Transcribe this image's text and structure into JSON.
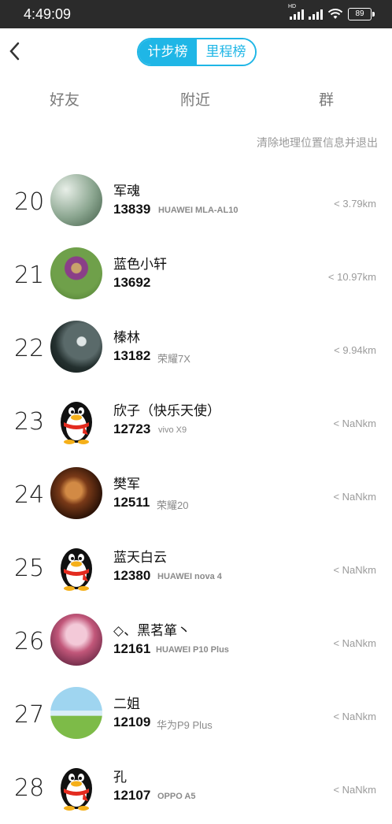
{
  "status_bar": {
    "time": "4:49:09",
    "battery": "89"
  },
  "header": {
    "segments": [
      {
        "label": "计步榜",
        "active": true
      },
      {
        "label": "里程榜",
        "active": false
      }
    ]
  },
  "tabs": [
    "好友",
    "附近",
    "群"
  ],
  "clear_location_link": "清除地理位置信息并退出",
  "rows": [
    {
      "rank": "20",
      "name": "军魂",
      "steps": "13839",
      "device": "HUAWEI MLA-AL10",
      "distance": "< 3.79km",
      "avatar": "photo-avatar"
    },
    {
      "rank": "21",
      "name": "蓝色小轩",
      "steps": "13692",
      "device": "",
      "distance": "< 10.97km",
      "avatar": "flower-avatar"
    },
    {
      "rank": "22",
      "name": "榛林",
      "steps": "13182",
      "device": "荣耀7X",
      "distance": "< 9.94km",
      "avatar": "eagle-avatar"
    },
    {
      "rank": "23",
      "name": "欣子（快乐天使）",
      "steps": "12723",
      "device": "vivo X9",
      "distance": "< NaNkm",
      "avatar": "qq-penguin-avatar"
    },
    {
      "rank": "24",
      "name": "樊军",
      "steps": "12511",
      "device": "荣耀20",
      "distance": "< NaNkm",
      "avatar": "violin-avatar"
    },
    {
      "rank": "25",
      "name": "蓝天白云",
      "steps": "12380",
      "device": "HUAWEI nova 4",
      "distance": "< NaNkm",
      "avatar": "qq-penguin-avatar"
    },
    {
      "rank": "26",
      "name": "◇、黑茗箪丶",
      "steps": "12161",
      "device": "HUAWEI P10 Plus",
      "distance": "< NaNkm",
      "avatar": "anime-avatar"
    },
    {
      "rank": "27",
      "name": "二姐",
      "steps": "12109",
      "device": "华为P9 Plus",
      "distance": "< NaNkm",
      "avatar": "landscape-avatar"
    },
    {
      "rank": "28",
      "name": "孔",
      "steps": "12107",
      "device": "OPPO A5",
      "distance": "< NaNkm",
      "avatar": "qq-penguin-avatar"
    }
  ],
  "colors": {
    "accent": "#1fb6e6",
    "muted": "#9a9a9a"
  }
}
